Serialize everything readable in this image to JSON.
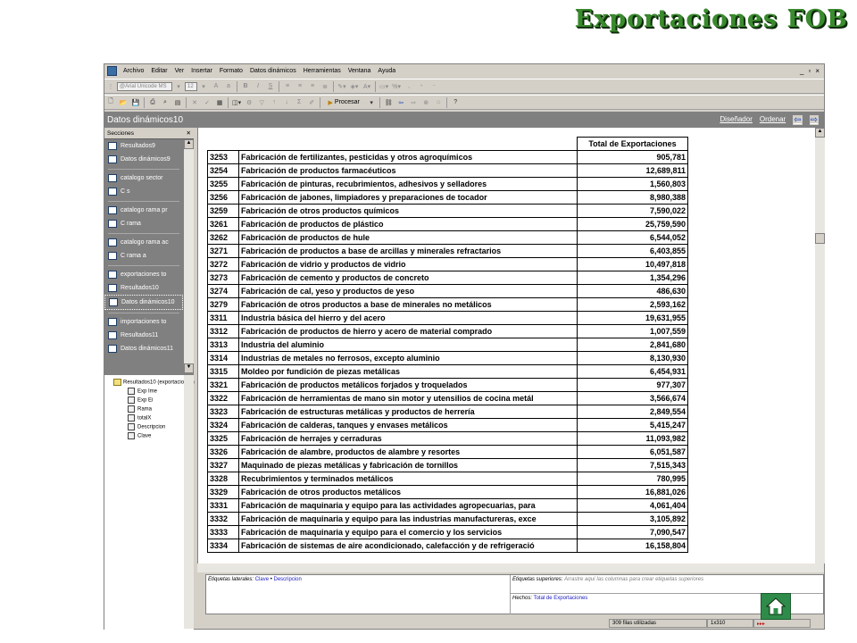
{
  "slide": {
    "title": "Exportaciones FOB"
  },
  "colors": {
    "title": "#3a8a2e",
    "panel": "#808080",
    "home_button": "#2e8b4a"
  },
  "menu": [
    "Archivo",
    "Editar",
    "Ver",
    "Insertar",
    "Formato",
    "Datos dinámicos",
    "Herramientas",
    "Ventana",
    "Ayuda"
  ],
  "toolbar": {
    "font_name": "@Arial Unicode MS",
    "font_size": "12",
    "procesar_label": "Procesar"
  },
  "window": {
    "title": "Datos dinámicos10",
    "disenador": "Diseñador",
    "ordenar": "Ordenar"
  },
  "sections_panel": {
    "header": "Secciones",
    "items": [
      {
        "label": "Resultados9",
        "selected": false
      },
      {
        "label": "Datos dinámicos9",
        "selected": false
      },
      {
        "label": "catalogo sector",
        "selected": false
      },
      {
        "label": "C s",
        "selected": false
      },
      {
        "label": "catalogo rama pr",
        "selected": false
      },
      {
        "label": "C rama",
        "selected": false
      },
      {
        "label": "catalogo rama ac",
        "selected": false
      },
      {
        "label": "C rama a",
        "selected": false
      },
      {
        "label": "exportaciones to",
        "selected": false
      },
      {
        "label": "Resultados10",
        "selected": false
      },
      {
        "label": "Datos dinámicos10",
        "selected": true
      },
      {
        "label": "importaciones to",
        "selected": false
      },
      {
        "label": "Resultados11",
        "selected": false
      },
      {
        "label": "Datos dinámicos11",
        "selected": false
      }
    ]
  },
  "tree": {
    "root": "Resultados10 (exportaciones)",
    "fields": [
      "Exp Ime",
      "Exp Ei",
      "Rama",
      "totalX",
      "Descripcion",
      "Clave"
    ]
  },
  "table": {
    "header": "Total de Exportaciones",
    "rows": [
      {
        "code": "3253",
        "desc": "Fabricación de fertilizantes, pesticidas y otros agroquímicos",
        "value": "905,781"
      },
      {
        "code": "3254",
        "desc": "Fabricación de productos farmacéuticos",
        "value": "12,689,811"
      },
      {
        "code": "3255",
        "desc": "Fabricación de pinturas, recubrimientos, adhesivos y selladores",
        "value": "1,560,803"
      },
      {
        "code": "3256",
        "desc": "Fabricación de jabones, limpiadores y preparaciones de tocador",
        "value": "8,980,388"
      },
      {
        "code": "3259",
        "desc": "Fabricación de otros productos químicos",
        "value": "7,590,022"
      },
      {
        "code": "3261",
        "desc": "Fabricación de productos de plástico",
        "value": "25,759,590"
      },
      {
        "code": "3262",
        "desc": "Fabricación de productos de hule",
        "value": "6,544,052"
      },
      {
        "code": "3271",
        "desc": "Fabricación de productos a base de arcillas y minerales refractarios",
        "value": "6,403,855"
      },
      {
        "code": "3272",
        "desc": "Fabricación de vidrio y productos de vidrio",
        "value": "10,497,818"
      },
      {
        "code": "3273",
        "desc": "Fabricación de cemento y productos de concreto",
        "value": "1,354,296"
      },
      {
        "code": "3274",
        "desc": "Fabricación de cal, yeso y productos de yeso",
        "value": "486,630"
      },
      {
        "code": "3279",
        "desc": "Fabricación de otros productos a base de minerales no metálicos",
        "value": "2,593,162"
      },
      {
        "code": "3311",
        "desc": "Industria básica del hierro y del acero",
        "value": "19,631,955"
      },
      {
        "code": "3312",
        "desc": "Fabricación de productos de hierro y acero de material comprado",
        "value": "1,007,559"
      },
      {
        "code": "3313",
        "desc": "Industria del aluminio",
        "value": "2,841,680"
      },
      {
        "code": "3314",
        "desc": "Industrias de metales no ferrosos, excepto aluminio",
        "value": "8,130,930"
      },
      {
        "code": "3315",
        "desc": "Moldeo por fundición de piezas metálicas",
        "value": "6,454,931"
      },
      {
        "code": "3321",
        "desc": "Fabricación de productos metálicos forjados y troquelados",
        "value": "977,307"
      },
      {
        "code": "3322",
        "desc": "Fabricación de herramientas de mano sin motor y utensilios de cocina metál",
        "value": "3,566,674"
      },
      {
        "code": "3323",
        "desc": "Fabricación de estructuras metálicas y productos de herrería",
        "value": "2,849,554"
      },
      {
        "code": "3324",
        "desc": "Fabricación de calderas, tanques y envases metálicos",
        "value": "5,415,247"
      },
      {
        "code": "3325",
        "desc": "Fabricación de herrajes y cerraduras",
        "value": "11,093,982"
      },
      {
        "code": "3326",
        "desc": "Fabricación de alambre, productos de alambre y resortes",
        "value": "6,051,587"
      },
      {
        "code": "3327",
        "desc": "Maquinado de piezas metálicas y fabricación de tornillos",
        "value": "7,515,343"
      },
      {
        "code": "3328",
        "desc": "Recubrimientos y terminados metálicos",
        "value": "780,995"
      },
      {
        "code": "3329",
        "desc": "Fabricación de otros productos metálicos",
        "value": "16,881,026"
      },
      {
        "code": "3331",
        "desc": "Fabricación de maquinaria y equipo para las actividades agropecuarias, para",
        "value": "4,061,404"
      },
      {
        "code": "3332",
        "desc": "Fabricación de maquinaria y equipo para las industrias manufactureras, exce",
        "value": "3,105,892"
      },
      {
        "code": "3333",
        "desc": "Fabricación de maquinaria y equipo para el comercio y los servicios",
        "value": "7,090,547"
      },
      {
        "code": "3334",
        "desc": "Fabricación de sistemas de aire acondicionado, calefacción y de refrigeració",
        "value": "16,158,804"
      }
    ]
  },
  "bottom_panel": {
    "lateral_label": "Etiquetas laterales:",
    "lateral_values": [
      "Clave",
      "Descripcion"
    ],
    "superior_label": "Etiquetas superiores:",
    "superior_hint": "Arrastre aquí las columnas para crear etiquetas superiores",
    "hechos_label": "Hechos:",
    "hechos_value": "Total de Exportaciones"
  },
  "status": {
    "rows_used": "309 filas utilizadas",
    "dims": "1x310"
  }
}
